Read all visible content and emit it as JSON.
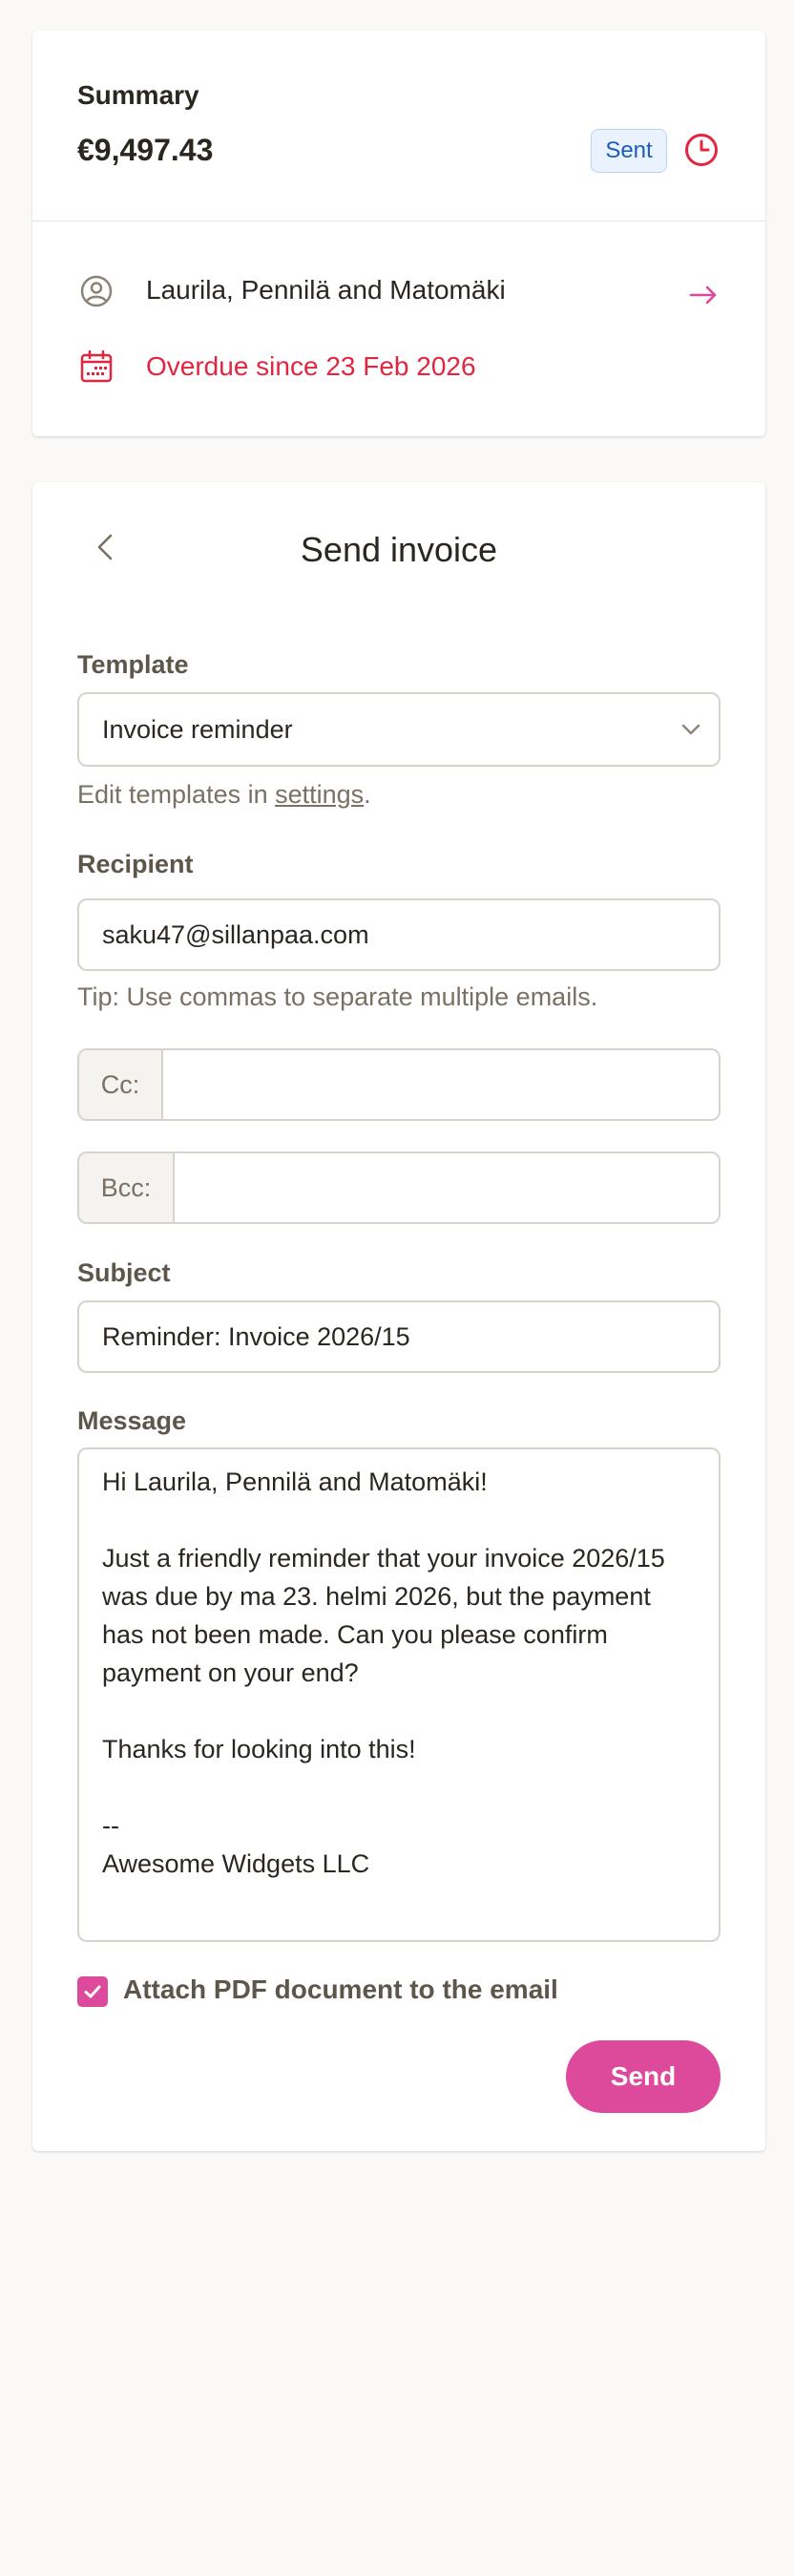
{
  "summary": {
    "heading": "Summary",
    "amount": "€9,497.43",
    "status": "Sent",
    "client_name": "Laurila, Pennilä and Matomäki",
    "overdue_text": "Overdue since 23 Feb 2026"
  },
  "form": {
    "title": "Send invoice",
    "template_label": "Template",
    "template_value": "Invoice reminder",
    "template_help_prefix": "Edit templates in ",
    "template_help_link": "settings",
    "template_help_suffix": ".",
    "recipient_label": "Recipient",
    "recipient_value": "saku47@sillanpaa.com",
    "recipient_tip": "Tip: Use commas to separate multiple emails.",
    "cc_label": "Cc:",
    "cc_value": "",
    "bcc_label": "Bcc:",
    "bcc_value": "",
    "subject_label": "Subject",
    "subject_value": "Reminder: Invoice 2026/15",
    "message_label": "Message",
    "message_value": "Hi Laurila, Pennilä and Matomäki!\n\nJust a friendly reminder that your invoice 2026/15 was due by ma 23. helmi 2026, but the payment has not been made. Can you please confirm payment on your end?\n\nThanks for looking into this!\n\n--\nAwesome Widgets LLC",
    "attach_label": "Attach PDF document to the email",
    "attach_checked": true,
    "send_label": "Send"
  },
  "icons": {
    "clock": "clock-icon",
    "client": "user-circle-icon",
    "arrow": "arrow-right-icon",
    "calendar": "calendar-icon",
    "back": "chevron-left-icon",
    "chevron": "chevron-down-icon",
    "check": "check-icon"
  },
  "colors": {
    "accent": "#dd4a9b",
    "overdue": "#e3263f",
    "badge_text": "#1d5bbf",
    "badge_bg": "#eaf3fd"
  }
}
